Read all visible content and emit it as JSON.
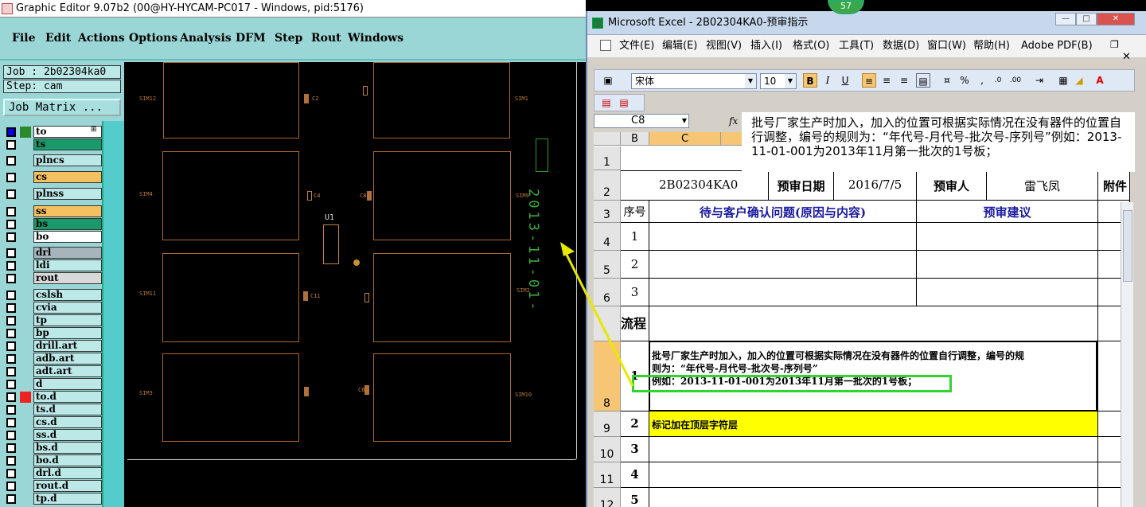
{
  "graphic_editor": {
    "title": "Graphic Editor 9.07b2 (00@HY-HYCAM-PC017 - Windows, pid:5176)",
    "menu": [
      "File",
      "Edit",
      "Actions",
      "Options",
      "Analysis",
      "DFM",
      "Step",
      "Rout",
      "Windows"
    ],
    "job": "Job : 2b02304ka0",
    "step": "Step: cam",
    "job_matrix_button": "Job Matrix ...",
    "layers": [
      {
        "name": "to",
        "swatch": "#2a8a2a",
        "checked": true,
        "color": "#ffffff"
      },
      {
        "name": "ts",
        "swatch": "",
        "checked": false,
        "color": "#1a9a6a"
      },
      {
        "name": "plncs",
        "swatch": "",
        "checked": false,
        "color": "#bde8e8"
      },
      {
        "name": "cs",
        "swatch": "",
        "checked": false,
        "color": "#f5c060"
      },
      {
        "name": "plnss",
        "swatch": "",
        "checked": false,
        "color": "#bde8e8"
      },
      {
        "name": "ss",
        "swatch": "",
        "checked": false,
        "color": "#f5c060"
      },
      {
        "name": "bs",
        "swatch": "",
        "checked": false,
        "color": "#1a9a6a"
      },
      {
        "name": "bo",
        "swatch": "",
        "checked": false,
        "color": "#ffffff"
      },
      {
        "name": "drl",
        "swatch": "",
        "checked": false,
        "color": "#a8b4bc"
      },
      {
        "name": "ldi",
        "swatch": "",
        "checked": false,
        "color": "#bde8e8"
      },
      {
        "name": "rout",
        "swatch": "",
        "checked": false,
        "color": "#d8d8d8"
      },
      {
        "name": "cslsh",
        "swatch": "",
        "checked": false,
        "color": "#bde8e8"
      },
      {
        "name": "cvia",
        "swatch": "",
        "checked": false,
        "color": "#bde8e8"
      },
      {
        "name": "tp",
        "swatch": "",
        "checked": false,
        "color": "#bde8e8"
      },
      {
        "name": "bp",
        "swatch": "",
        "checked": false,
        "color": "#bde8e8"
      },
      {
        "name": "drill.art",
        "swatch": "",
        "checked": false,
        "color": "#bde8e8"
      },
      {
        "name": "adb.art",
        "swatch": "",
        "checked": false,
        "color": "#bde8e8"
      },
      {
        "name": "adt.art",
        "swatch": "",
        "checked": false,
        "color": "#bde8e8"
      },
      {
        "name": "d",
        "swatch": "",
        "checked": false,
        "color": "#bde8e8"
      },
      {
        "name": "to.d",
        "swatch": "#ee2222",
        "checked": false,
        "color": "#bde8e8"
      },
      {
        "name": "ts.d",
        "swatch": "",
        "checked": false,
        "color": "#bde8e8"
      },
      {
        "name": "cs.d",
        "swatch": "",
        "checked": false,
        "color": "#bde8e8"
      },
      {
        "name": "ss.d",
        "swatch": "",
        "checked": false,
        "color": "#bde8e8"
      },
      {
        "name": "bs.d",
        "swatch": "",
        "checked": false,
        "color": "#bde8e8"
      },
      {
        "name": "bo.d",
        "swatch": "",
        "checked": false,
        "color": "#bde8e8"
      },
      {
        "name": "drl.d",
        "swatch": "",
        "checked": false,
        "color": "#bde8e8"
      },
      {
        "name": "rout.d",
        "swatch": "",
        "checked": false,
        "color": "#bde8e8"
      },
      {
        "name": "tp.d",
        "swatch": "",
        "checked": false,
        "color": "#bde8e8"
      }
    ],
    "canvas": {
      "sim_labels": [
        "SIM12",
        "SIM1",
        "SIM4",
        "SIM9",
        "SIM11",
        "SIM2",
        "SIM3",
        "SIM10"
      ],
      "comp_labels": [
        "C2",
        "C4",
        "C8",
        "C11",
        "C6"
      ],
      "u1_label": "U1",
      "date_mark": "2013-11-01-"
    }
  },
  "excel": {
    "title": "Microsoft Excel - 2B02304KA0-预审指示",
    "menu": [
      "文件(E)",
      "编辑(E)",
      "视图(V)",
      "插入(I)",
      "格式(O)",
      "工具(T)",
      "数据(D)",
      "窗口(W)",
      "帮助(H)",
      "Adobe PDF(B)"
    ],
    "font_name": "宋体",
    "font_size": "10",
    "name_box": "C8",
    "fx": "fx",
    "formula_text": "批号厂家生产时加入，加入的位置可根据实际情况在没有器件的位置自行调整，编号的规则为：“年代号-月代号-批次号-序列号”例如：2013-11-01-001为2013年11月第一批次的1号板；",
    "col_headers": [
      "B",
      "C"
    ],
    "rows": [
      "1",
      "2",
      "3",
      "4",
      "5",
      "6",
      "",
      "8",
      "9",
      "10",
      "11",
      "12"
    ],
    "header_row": {
      "job_no": "2B02304KA0",
      "date_label": "预审日期",
      "date_value": "2016/7/5",
      "person_label": "预审人",
      "person_value": "雷飞凤",
      "attach_label": "附件"
    },
    "subheader": {
      "seq": "序号",
      "issue": "待与客户确认问题(原因与内容)",
      "suggestion": "预审建议"
    },
    "issue_rows": [
      "1",
      "2",
      "3"
    ],
    "process_label": "流程",
    "instruction_rows": [
      {
        "no": "1",
        "text_line1": "批号厂家生产时加入，加入的位置可根据实际情况在没有器件的位置自行调整，编号的规",
        "text_line2": "则为：“年代号-月代号-批次号-序列号”",
        "text_line3": "例如：2013-11-01-001为2013年11月第一批次的1号板；"
      },
      {
        "no": "2",
        "text": "标记加在顶层字符层"
      },
      {
        "no": "3",
        "text": ""
      },
      {
        "no": "4",
        "text": ""
      },
      {
        "no": "5",
        "text": ""
      }
    ],
    "highlight_color": "#ffff00"
  },
  "badge": "57"
}
